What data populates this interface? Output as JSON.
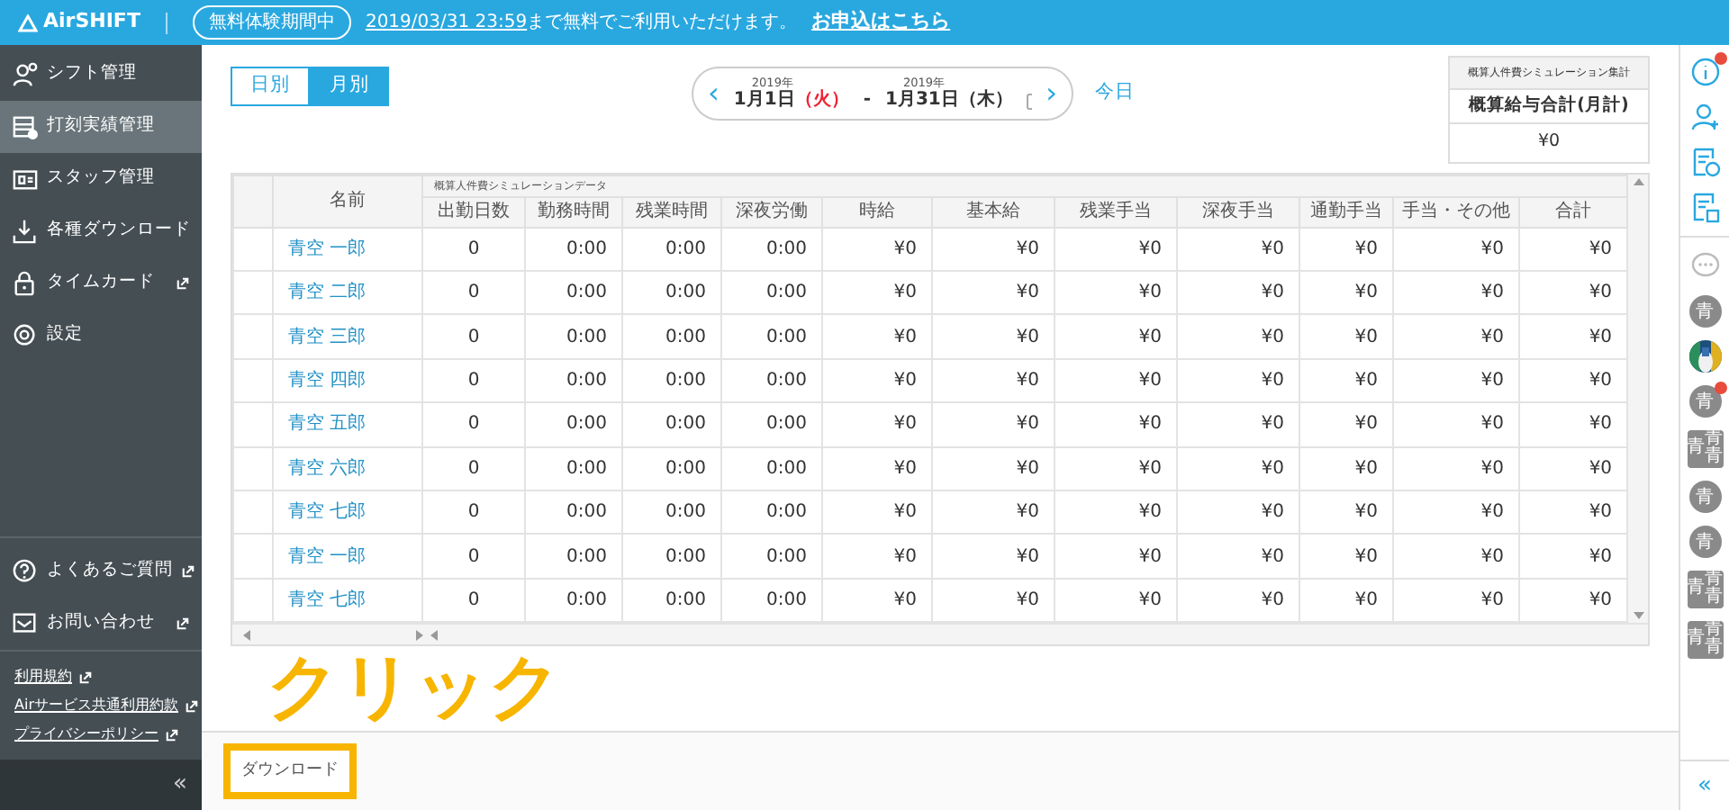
{
  "header": {
    "logo": "AirSHIFT",
    "trial_badge": "無料体験期間中",
    "notice": "2019/03/31 23:59",
    "notice_rest": "まで無料でご利用いただけます。",
    "apply_link": "お申込はこちら"
  },
  "sidebar": {
    "items": [
      {
        "label": "シフト管理",
        "selected": false,
        "external": false
      },
      {
        "label": "打刻実績管理",
        "selected": true,
        "external": false
      },
      {
        "label": "スタッフ管理",
        "selected": false,
        "external": false
      },
      {
        "label": "各種ダウンロード",
        "selected": false,
        "external": false
      },
      {
        "label": "タイムカード",
        "selected": false,
        "external": true
      },
      {
        "label": "設定",
        "selected": false,
        "external": false
      }
    ],
    "help_items": [
      {
        "label": "よくあるご質問",
        "external": true
      },
      {
        "label": "お問い合わせ",
        "external": true
      }
    ],
    "footer_links": [
      "利用規約",
      "Airサービス共通利用約款",
      "プライバシーポリシー"
    ],
    "collapse": "«"
  },
  "view_toggle": [
    {
      "label": "日別",
      "selected": false
    },
    {
      "label": "月別",
      "selected": true
    }
  ],
  "date_nav": {
    "prev": "‹",
    "next": "›",
    "today": "今日",
    "separator": "-",
    "dates": [
      {
        "year": "2019年",
        "date": "1月1日",
        "weekday": "（火）",
        "highlighted": true
      },
      {
        "year": "2019年",
        "date": "1月31日",
        "weekday": "（木）",
        "highlighted": false
      }
    ]
  },
  "summary": {
    "caption": "概算人件費シミュレーション集計",
    "heading": "概算給与合計(月計)",
    "value": "¥0"
  },
  "table": {
    "name_column": "名前",
    "group_label": "概算人件費シミュレーションデータ",
    "columns": [
      "出勤日数",
      "勤務時間",
      "残業時間",
      "深夜労働",
      "時給",
      "基本給",
      "残業手当",
      "深夜手当",
      "通勤手当",
      "手当・その他",
      "合計"
    ],
    "rows": [
      {
        "name": "青空 一郎",
        "values": [
          "0",
          "0:00",
          "0:00",
          "0:00",
          "¥0",
          "¥0",
          "¥0",
          "¥0",
          "¥0",
          "¥0",
          "¥0"
        ]
      },
      {
        "name": "青空 二郎",
        "values": [
          "0",
          "0:00",
          "0:00",
          "0:00",
          "¥0",
          "¥0",
          "¥0",
          "¥0",
          "¥0",
          "¥0",
          "¥0"
        ]
      },
      {
        "name": "青空 三郎",
        "values": [
          "0",
          "0:00",
          "0:00",
          "0:00",
          "¥0",
          "¥0",
          "¥0",
          "¥0",
          "¥0",
          "¥0",
          "¥0"
        ]
      },
      {
        "name": "青空 四郎",
        "values": [
          "0",
          "0:00",
          "0:00",
          "0:00",
          "¥0",
          "¥0",
          "¥0",
          "¥0",
          "¥0",
          "¥0",
          "¥0"
        ]
      },
      {
        "name": "青空 五郎",
        "values": [
          "0",
          "0:00",
          "0:00",
          "0:00",
          "¥0",
          "¥0",
          "¥0",
          "¥0",
          "¥0",
          "¥0",
          "¥0"
        ]
      },
      {
        "name": "青空 六郎",
        "values": [
          "0",
          "0:00",
          "0:00",
          "0:00",
          "¥0",
          "¥0",
          "¥0",
          "¥0",
          "¥0",
          "¥0",
          "¥0"
        ]
      },
      {
        "name": "青空 七郎",
        "values": [
          "0",
          "0:00",
          "0:00",
          "0:00",
          "¥0",
          "¥0",
          "¥0",
          "¥0",
          "¥0",
          "¥0",
          "¥0"
        ]
      },
      {
        "name": "青空 一郎",
        "values": [
          "0",
          "0:00",
          "0:00",
          "0:00",
          "¥0",
          "¥0",
          "¥0",
          "¥0",
          "¥0",
          "¥0",
          "¥0"
        ]
      },
      {
        "name": "青空 七郎",
        "values": [
          "0",
          "0:00",
          "0:00",
          "0:00",
          "¥0",
          "¥0",
          "¥0",
          "¥0",
          "¥0",
          "¥0",
          "¥0"
        ]
      }
    ]
  },
  "annotation": "クリック",
  "download_button": "ダウンロード",
  "right_rail": {
    "tools": [
      {
        "badge": true
      },
      {
        "badge": false
      },
      {
        "badge": false
      },
      {
        "badge": false
      },
      {
        "badge": false
      }
    ],
    "avatars": [
      {
        "kind": "circle",
        "text": "青",
        "badge": false
      },
      {
        "kind": "picture",
        "badge": false
      },
      {
        "kind": "circle",
        "text": "青",
        "badge": true
      },
      {
        "kind": "group",
        "texts": [
          "青",
          "青",
          "青"
        ],
        "badge": false
      },
      {
        "kind": "circle",
        "text": "青",
        "badge": false
      },
      {
        "kind": "circle",
        "text": "青",
        "badge": false
      },
      {
        "kind": "group",
        "texts": [
          "青",
          "青",
          "青"
        ],
        "badge": false
      },
      {
        "kind": "group",
        "texts": [
          "青",
          "青",
          "青"
        ],
        "badge": false
      }
    ],
    "collapse": "«"
  }
}
